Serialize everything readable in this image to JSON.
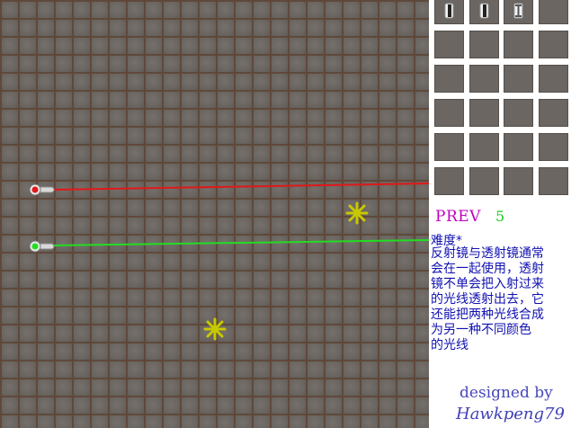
{
  "colors": {
    "board": "#6a6560",
    "grid_line": "#5f4637",
    "red_beam": "#e01818",
    "green_beam": "#22dd22",
    "target_star": "#c8c800",
    "prev_text": "#c000c0",
    "level_text": "#1ec81e",
    "description_text": "#1010b0",
    "credit_text": "#4848b8"
  },
  "board": {
    "emitters": [
      {
        "name": "red-emitter",
        "color": "#e01818",
        "icon": "laser-emitter-icon"
      },
      {
        "name": "green-emitter",
        "color": "#22dd22",
        "icon": "laser-emitter-icon"
      }
    ],
    "targets": [
      {
        "icon": "star-target-icon",
        "color": "#c8c800"
      },
      {
        "icon": "star-target-icon",
        "color": "#c8c800"
      }
    ]
  },
  "palette": {
    "rows": 6,
    "columns": 4,
    "pieces": [
      {
        "slot": 0,
        "icon": "reflecting-mirror-icon"
      },
      {
        "slot": 1,
        "icon": "reflecting-mirror-icon"
      },
      {
        "slot": 2,
        "icon": "transmitting-mirror-icon"
      }
    ]
  },
  "info": {
    "prev_label": "PREV",
    "level_number": "5",
    "difficulty": "难度*",
    "description_lines": [
      "反射镜与透射镜通常",
      "会在一起使用，透射",
      "镜不单会把入射过来",
      "的光线透射出去，它",
      "还能把两种光线合成",
      "为另一种不同颜色",
      "的光线"
    ],
    "designed_by": "designed by",
    "author": "Hawkpeng79"
  }
}
